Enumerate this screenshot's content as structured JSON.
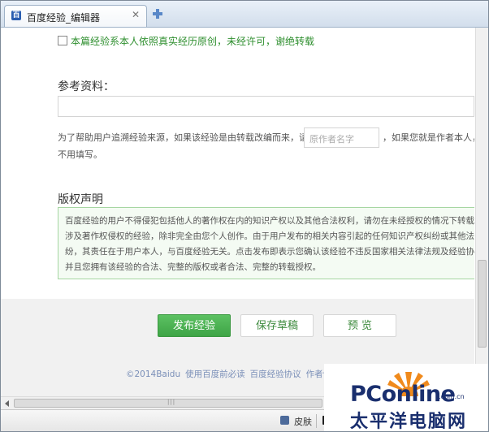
{
  "tab": {
    "favicon": "百",
    "title": "百度经验_编辑器",
    "close": "✕"
  },
  "original_note": "本篇经验系本人依照真实经历原创，未经许可，谢绝转载",
  "reference": {
    "title": "参考资料："
  },
  "hint": {
    "line1_before": "为了帮助用户追溯经验来源，如果该经验是由转载改编而来，请填写",
    "author_placeholder": "原作者名字",
    "line1_after": "，如果您就是作者本人，则",
    "line2": "不用填写。"
  },
  "copyright": {
    "title": "版权声明",
    "lines": [
      "百度经验的用户不得侵犯包括他人的著作权在内的知识产权以及其他合法权利，请勿在未经授权的情况下转载任何",
      "涉及著作权侵权的经验，除非完全由您个人创作。由于用户发布的相关内容引起的任何知识产权纠纷或其他法律纠",
      "纷，其责任在于用户本人，与百度经验无关。点击发布即表示您确认该经验不违反国家相关法律法规及经验协议，",
      "并且您拥有该经验的合法、完整的版权或者合法、完整的转载授权。"
    ]
  },
  "buttons": {
    "publish": "发布经验",
    "save_draft": "保存草稿",
    "preview": "预 览"
  },
  "footer": {
    "copyright": "©2014Baidu",
    "link1": "使用百度前必读",
    "link2": "百度经验协议",
    "link3": "作者创作作"
  },
  "statusbar": {
    "skin": "皮肤"
  },
  "watermark": {
    "logo": "PConline",
    "domain": ".com.cn",
    "cn_name": "太平洋电脑网"
  },
  "colors": {
    "accent_green": "#3ea446",
    "link_blue": "#7a8fb8",
    "watermark_navy": "#1a2f6e",
    "watermark_orange": "#f08a1c"
  }
}
